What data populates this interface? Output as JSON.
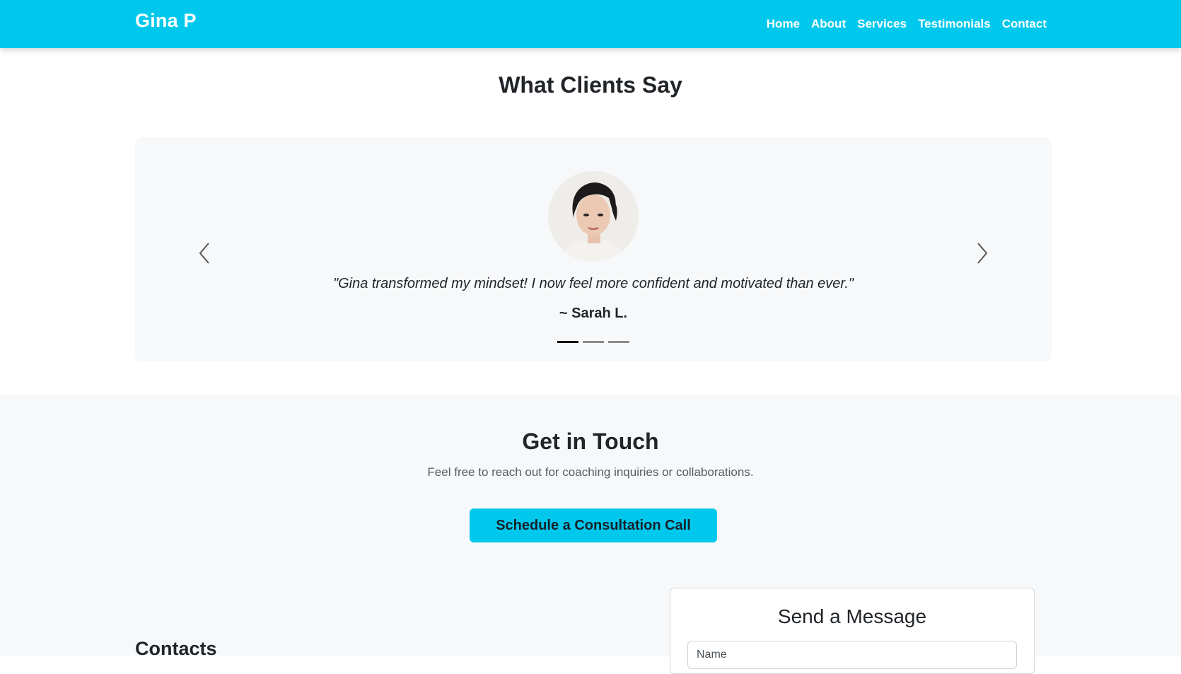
{
  "nav": {
    "brand": "Gina P",
    "links": [
      {
        "label": "Home"
      },
      {
        "label": "About"
      },
      {
        "label": "Services"
      },
      {
        "label": "Testimonials"
      },
      {
        "label": "Contact"
      }
    ]
  },
  "testimonials": {
    "title": "What Clients Say",
    "quote": "\"Gina transformed my mindset! I now feel more confident and motivated than ever.\"",
    "author": "~ Sarah L.",
    "active_slide": 1,
    "slide_count": 3
  },
  "contact": {
    "title": "Get in Touch",
    "subtitle": "Feel free to reach out for coaching inquiries or collaborations.",
    "cta_label": "Schedule a Consultation Call",
    "contacts_heading": "Contacts",
    "form": {
      "title": "Send a Message",
      "name_placeholder": "Name"
    }
  },
  "colors": {
    "brand": "#00c8ec",
    "section_bg": "#f7f8f9"
  },
  "icons": [
    "chevron-left-icon",
    "chevron-right-icon"
  ]
}
